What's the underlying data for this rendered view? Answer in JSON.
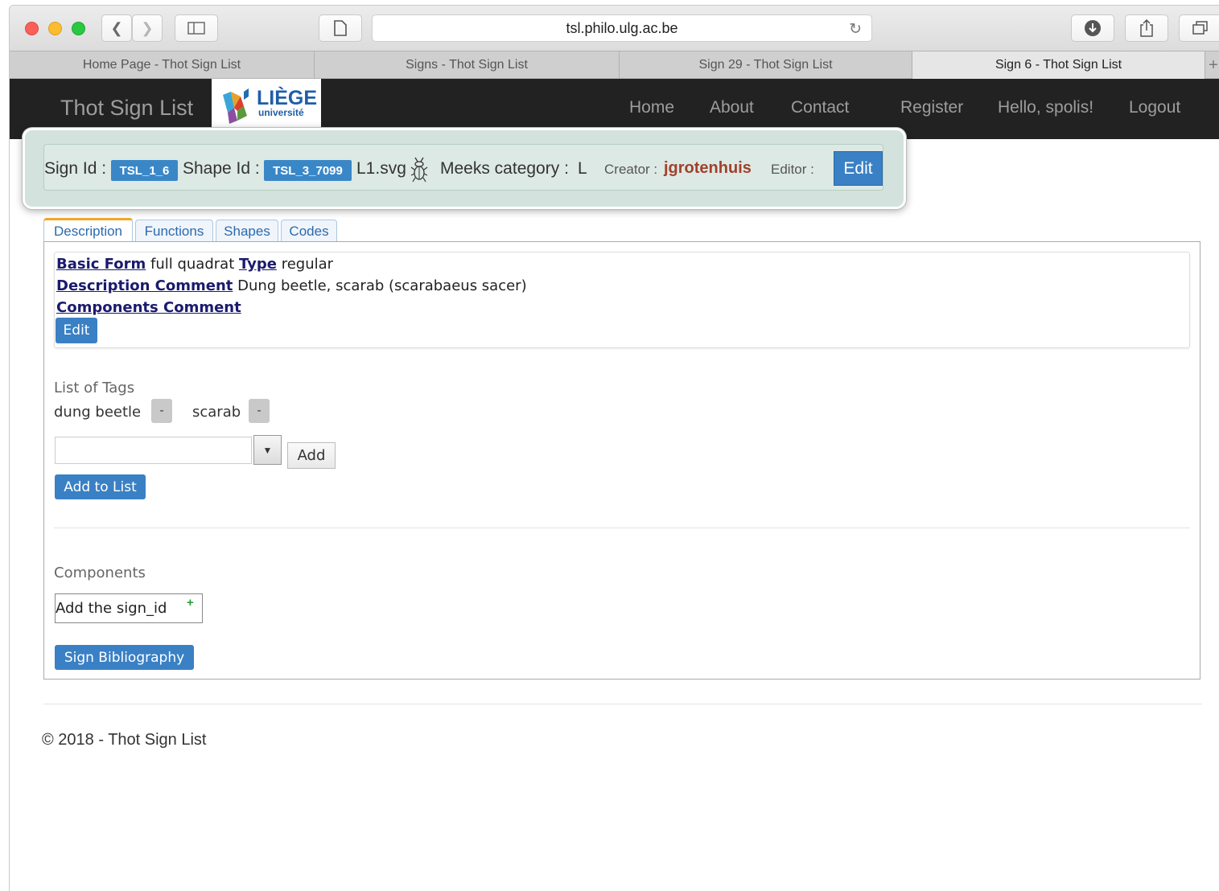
{
  "browser": {
    "url": "tsl.philo.ulg.ac.be",
    "tabs": [
      {
        "label": "Home Page - Thot Sign List"
      },
      {
        "label": "Signs - Thot Sign List"
      },
      {
        "label": "Sign 29 - Thot Sign List"
      },
      {
        "label": "Sign 6 - Thot Sign List"
      }
    ],
    "new_tab": "+"
  },
  "navbar": {
    "brand": "Thot Sign List",
    "logo_text": "LIÈGE",
    "logo_subtext": "université",
    "links": {
      "home": "Home",
      "about": "About",
      "contact": "Contact",
      "register": "Register",
      "hello": "Hello, spolis!",
      "logout": "Logout"
    }
  },
  "sign_info": {
    "sign_id_label": "Sign Id :",
    "sign_id": "TSL_1_6",
    "shape_id_label": "Shape Id :",
    "shape_id": "TSL_3_7099",
    "file": "L1.svg",
    "meeks_label": "Meeks category :",
    "meeks_value": "L",
    "creator_label": "Creator :",
    "creator": "jgrotenhuis",
    "editor_label": "Editor :",
    "edit_button": "Edit"
  },
  "tabs": {
    "description": "Description",
    "functions": "Functions",
    "shapes": "Shapes",
    "codes": "Codes"
  },
  "description": {
    "basic_form_label": "Basic Form",
    "basic_form_value": "full quadrat",
    "type_label": "Type",
    "type_value": "regular",
    "desc_comment_label": "Description Comment",
    "desc_comment_value": "Dung beetle, scarab (scarabaeus sacer)",
    "components_comment_label": "Components Comment",
    "edit_button": "Edit"
  },
  "tags": {
    "heading": "List of Tags",
    "items": [
      "dung beetle",
      "scarab"
    ],
    "remove_label": "-",
    "add_button": "Add",
    "add_to_list_button": "Add to List"
  },
  "components": {
    "heading": "Components",
    "input_value": "Add the sign_id",
    "plus": "+",
    "bibliography_button": "Sign Bibliography"
  },
  "footer": {
    "text": "© 2018 - Thot Sign List"
  }
}
